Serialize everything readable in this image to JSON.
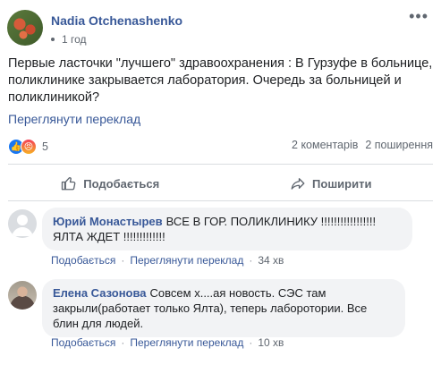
{
  "post": {
    "author": "Nadia Otchenashenko",
    "time": "1 год",
    "text": "Первые ласточки \"лучшего\" здравоохранения : В Гурзуфе в больнице, поликлинике закрывается лаборатория. Очередь за больницей и поликлиникой?",
    "translate_label": "Переглянути переклад",
    "reactions_count": "5",
    "comments_count": "2 коментарів",
    "shares_count": "2 поширення"
  },
  "actions": {
    "like_label": "Подобається",
    "share_label": "Поширити"
  },
  "comments": [
    {
      "author": "Юрий Монастырев",
      "text": "ВСЕ В ГОР. ПОЛИКЛИНИКУ !!!!!!!!!!!!!!!!! ЯЛТА ЖДЕТ !!!!!!!!!!!!!",
      "like_label": "Подобається",
      "translate_label": "Переглянути переклад",
      "time": "34 хв"
    },
    {
      "author": "Елена Сазонова",
      "text": "Совсем х....ая новость. СЭС там закрыли(работает только Ялта), теперь лаборотории. Все блин для людей.",
      "like_label": "Подобається",
      "translate_label": "Переглянути переклад",
      "time": "10 хв"
    }
  ],
  "icons": [
    "globe-icon",
    "more-icon",
    "like-reaction-icon",
    "angry-reaction-icon",
    "thumbs-up-icon",
    "share-arrow-icon"
  ]
}
